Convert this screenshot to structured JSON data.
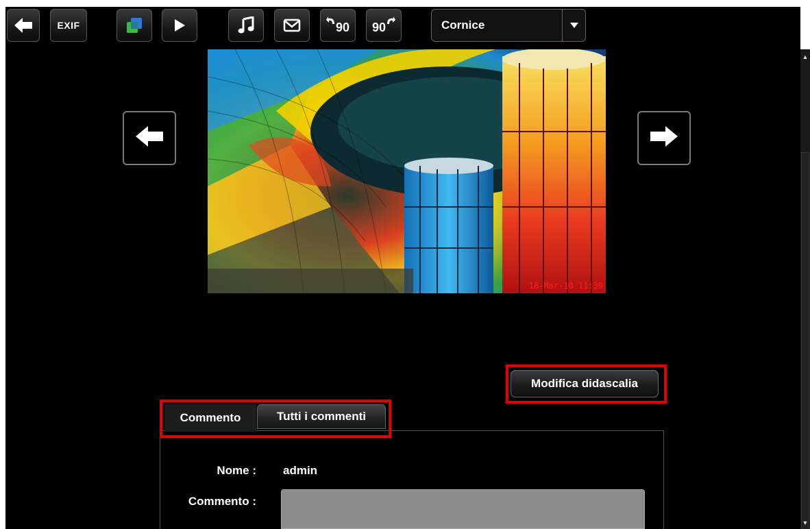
{
  "toolbar": {
    "exif_label": "EXIF",
    "rotate_left_label": "90",
    "rotate_right_label": "90",
    "frame_select": {
      "value": "Cornice"
    }
  },
  "photo": {
    "timestamp": "18-Mar-10 11:39"
  },
  "caption_button": {
    "label": "Modifica didascalia"
  },
  "tabs": [
    {
      "label": "Commento",
      "active": true
    },
    {
      "label": "Tutti i commenti",
      "active": false
    }
  ],
  "form": {
    "name_label": "Nome :",
    "name_value": "admin",
    "comment_label": "Commento :",
    "comment_value": ""
  },
  "colors": {
    "highlight": "#e10000",
    "background": "#000000",
    "comment_box": "#8c8c8c"
  }
}
